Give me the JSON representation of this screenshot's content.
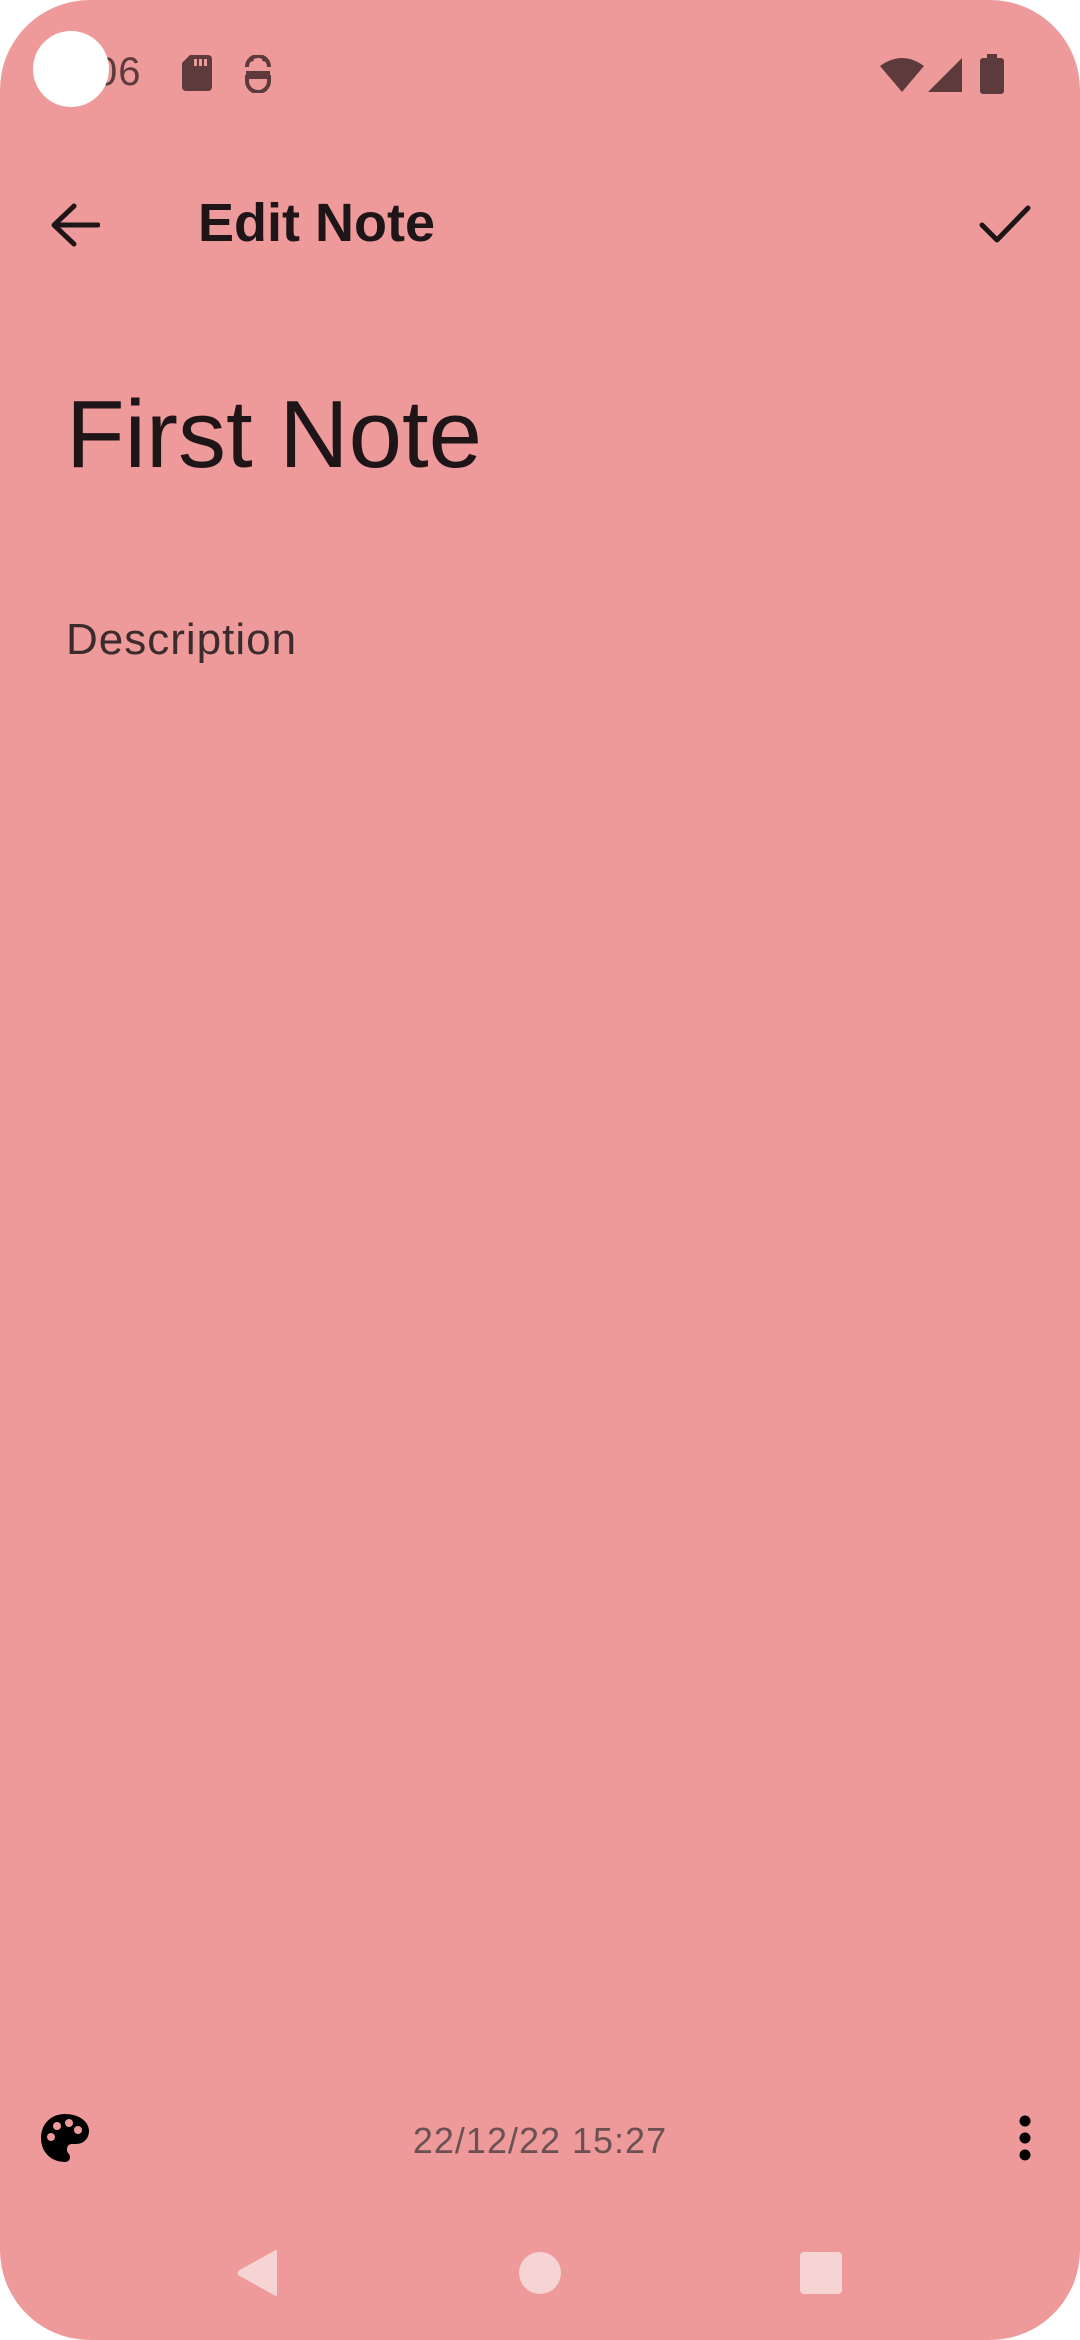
{
  "status_bar": {
    "time": "06",
    "icons": [
      "sd-card-icon",
      "android-debug-icon",
      "wifi-icon",
      "cell-signal-icon",
      "battery-icon"
    ]
  },
  "app_bar": {
    "title": "Edit Note",
    "back_icon": "arrow-back-icon",
    "save_icon": "check-icon"
  },
  "note": {
    "title": "First Note",
    "description_placeholder": "Description"
  },
  "bottom_bar": {
    "timestamp": "22/12/22 15:27",
    "palette_icon": "palette-icon",
    "more_icon": "more-vert-icon"
  },
  "nav_bar": {
    "icons": [
      "nav-back-icon",
      "nav-home-icon",
      "nav-recents-icon"
    ]
  },
  "colors": {
    "background": "#ee9a9b",
    "text": "#1d1517"
  }
}
